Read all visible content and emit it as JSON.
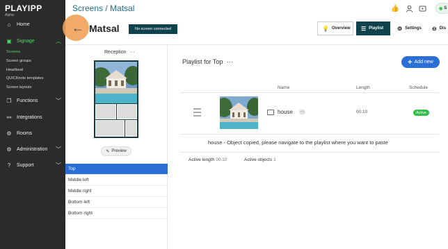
{
  "app": {
    "logo": "PLAYIPP",
    "logo_sub": "Alpha"
  },
  "sidebar": {
    "items": [
      {
        "label": "Home",
        "icon": "home-icon"
      },
      {
        "label": "Signage",
        "icon": "signage-icon",
        "active": true
      },
      {
        "label": "Functions",
        "icon": "functions-icon"
      },
      {
        "label": "Integrations",
        "icon": "integrations-icon"
      },
      {
        "label": "Rooms",
        "icon": "rooms-icon"
      },
      {
        "label": "Administration",
        "icon": "administration-icon"
      },
      {
        "label": "Support",
        "icon": "support-icon"
      }
    ],
    "sub_items": [
      "Screens",
      "Screen groups",
      "Heartbeat",
      "QUICKnote templates",
      "Screen layouts"
    ]
  },
  "header": {
    "breadcrumb": "Screens / Matsal",
    "s_button": "S"
  },
  "screen": {
    "title": "Matsal",
    "status": "No screen connected",
    "back_icon": "arrow-left-icon"
  },
  "tabs": [
    {
      "label": "Overview",
      "icon": "bulb-icon"
    },
    {
      "label": "Playlist",
      "icon": "playlist-icon",
      "active": true
    },
    {
      "label": "Settings",
      "icon": "gear-icon"
    },
    {
      "label": "Dis",
      "icon": "display-icon"
    }
  ],
  "layout": {
    "name": "Reception",
    "menu": "···",
    "preview_label": "Preview",
    "zones": [
      "Top",
      "Middle left",
      "Middle right",
      "Bottom left",
      "Bottom right"
    ],
    "active_zone": "Top"
  },
  "playlist": {
    "title": "Playlist for Top",
    "menu": "···",
    "add_label": "Add new",
    "columns": {
      "name": "Name",
      "length": "Length",
      "schedule": "Schedule"
    },
    "items": [
      {
        "name": "house",
        "length": "00:10",
        "schedule": "Active",
        "dots": "···"
      }
    ],
    "notice": "house - Object copied, please navigate to the playlist where you want to paste",
    "footer": {
      "active_length_label": "Active length",
      "active_length_value": "00:10",
      "active_objects_label": "Active objects",
      "active_objects_value": "1"
    }
  },
  "colors": {
    "accent": "#10424d",
    "link": "#1f6f8b",
    "primary": "#2b6fd6",
    "success": "#2ec04a",
    "sidebar": "#2b2b2b",
    "highlight": "#f0a15a"
  }
}
